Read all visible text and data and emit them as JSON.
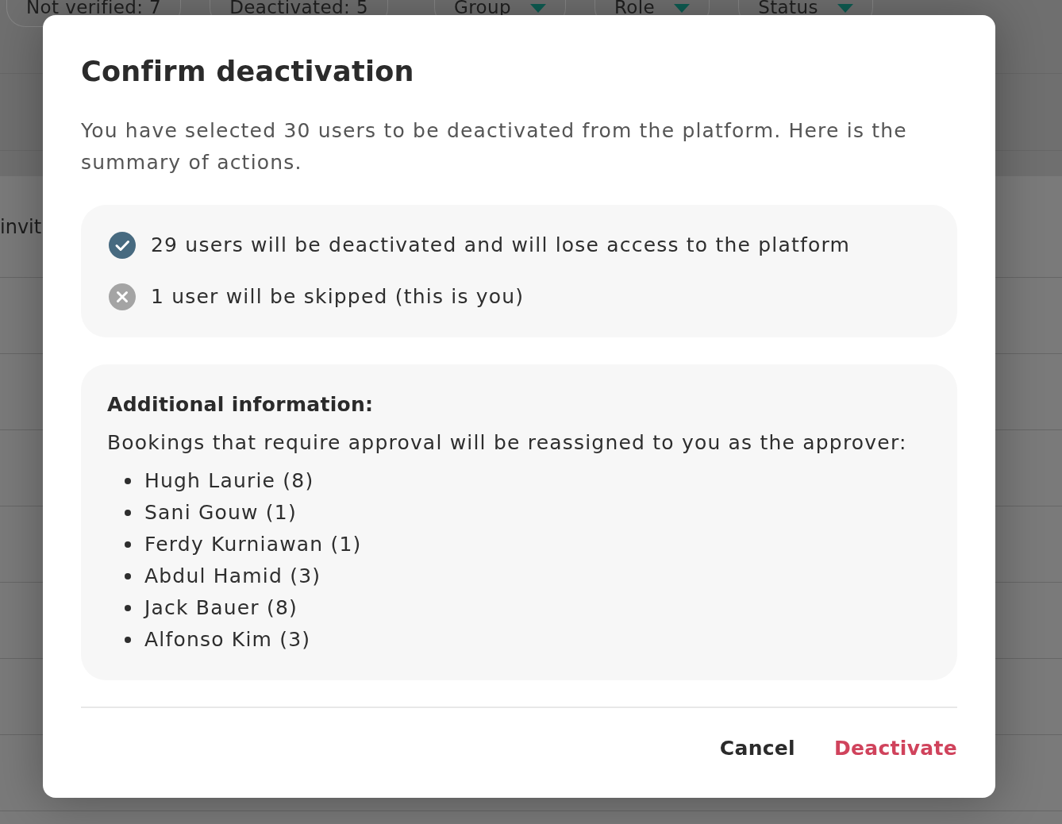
{
  "background": {
    "filters": [
      {
        "kind": "count",
        "label": "Not verified: 7"
      },
      {
        "kind": "count",
        "label": "Deactivated: 5"
      },
      {
        "kind": "dropdown",
        "label": "Group"
      },
      {
        "kind": "dropdown",
        "label": "Role"
      },
      {
        "kind": "dropdown",
        "label": "Status"
      }
    ],
    "table_rows": [
      {
        "column_1": "invit"
      }
    ]
  },
  "dialog": {
    "title": "Confirm deactivation",
    "message": "You have selected 30 users to be deactivated from the platform. Here is the summary of actions.",
    "summary": [
      {
        "kind": "success",
        "text": "29 users will be deactivated and will lose access to the platform"
      },
      {
        "kind": "skipped",
        "text": "1 user will be skipped (this is you)"
      }
    ],
    "additional": {
      "heading": "Additional information:",
      "text": "Bookings that require approval will be reassigned to you as the approver:",
      "approvers": [
        "Hugh Laurie (8)",
        "Sani Gouw (1)",
        "Ferdy Kurniawan (1)",
        "Abdul Hamid (3)",
        "Jack Bauer (8)",
        "Alfonso Kim (3)"
      ]
    },
    "buttons": [
      {
        "kind": "secondary",
        "label": "Cancel"
      },
      {
        "kind": "danger",
        "label": "Deactivate"
      }
    ]
  }
}
